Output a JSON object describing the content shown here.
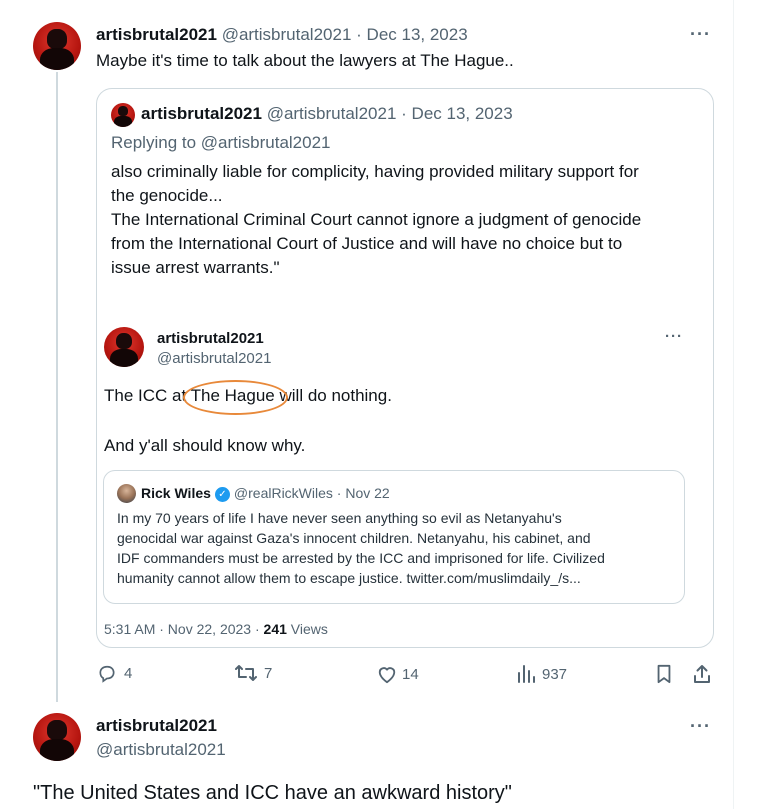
{
  "tweet": {
    "author_name": "artisbrutal2021",
    "author_handle": "@artisbrutal2021",
    "date": "Dec 13, 2023",
    "separator": "·",
    "text": "Maybe it's time to talk about the lawyers at The Hague..",
    "more": "···",
    "quote": {
      "author_name": "artisbrutal2021",
      "author_handle": "@artisbrutal2021",
      "date": "Dec 13, 2023",
      "replying_to": "Replying to @artisbrutal2021",
      "lines": [
        "also criminally liable for complicity, having provided military support for",
        "the genocide...",
        "The International Criminal Court cannot ignore a judgment of genocide",
        "from the International Court of Justice and will have no choice but to",
        "issue arrest warrants.\""
      ],
      "screenshot": {
        "author_name": "artisbrutal2021",
        "author_handle": "@artisbrutal2021",
        "more": "···",
        "text_prefix": "The ICC at",
        "text_highlight": "The Hague",
        "text_suffix": "will do nothing.",
        "text_line2": "And y'all should know why.",
        "embed": {
          "author_name": "Rick Wiles",
          "verified_glyph": "✓",
          "handle_date": "@realRickWiles · Nov 22",
          "lines": [
            "In my 70 years of life I have never seen anything so evil as Netanyahu's",
            "genocidal war against Gaza's innocent children. Netanyahu, his cabinet, and",
            "IDF commanders must be arrested by the ICC and imprisoned for life. Civilized",
            "humanity cannot allow them to escape justice. twitter.com/muslimdaily_/s..."
          ]
        },
        "timestamp": "5:31 AM · Nov 22, 2023 · ",
        "views_count": "241",
        "views_label": " Views"
      }
    },
    "actions": {
      "replies": "4",
      "retweets": "7",
      "likes": "14",
      "views": "937"
    }
  },
  "reply": {
    "author_name": "artisbrutal2021",
    "author_handle": "@artisbrutal2021",
    "more": "···",
    "text": "\"The United States and ICC have an awkward history\""
  },
  "colors": {
    "accent": "#1d9bf0",
    "muted": "#536471",
    "border": "#cfd9de",
    "highlight_circle": "#e8893a"
  }
}
